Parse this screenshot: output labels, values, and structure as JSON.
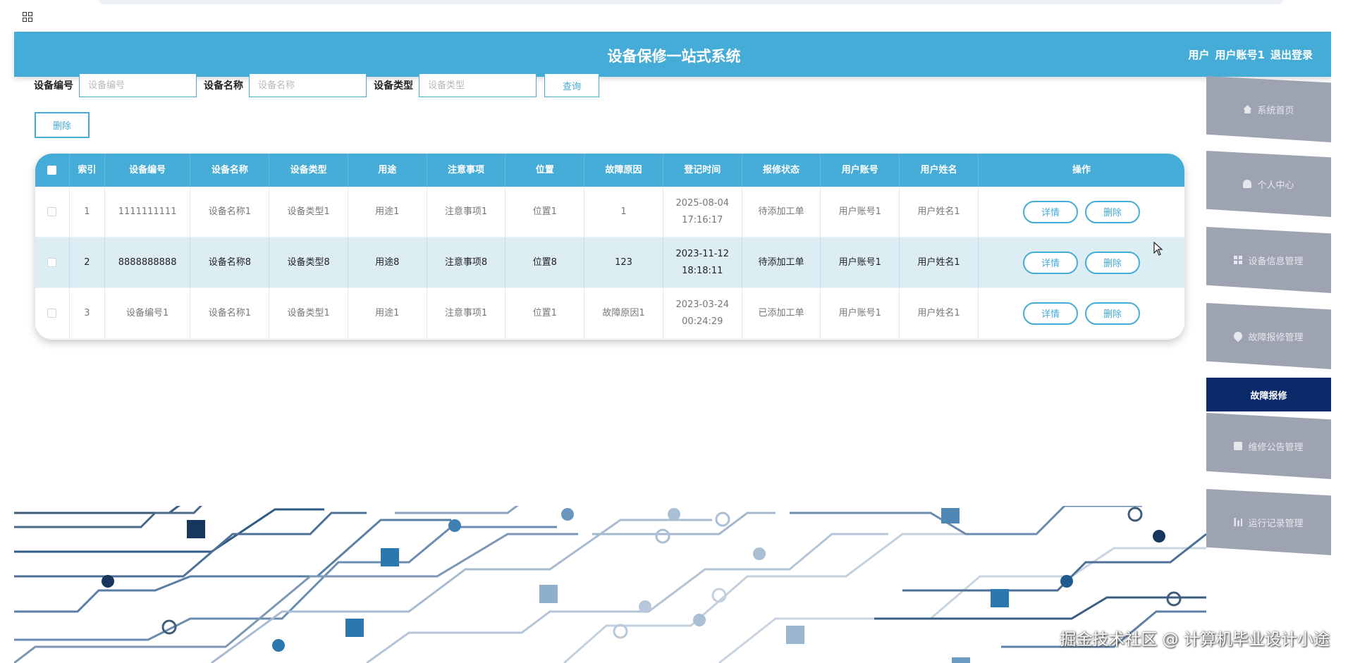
{
  "header": {
    "title": "设备保修一站式系统",
    "user_label": "用户",
    "user_account": "用户账号1",
    "logout": "退出登录"
  },
  "search": {
    "fields": [
      {
        "label": "设备编号",
        "placeholder": "设备编号"
      },
      {
        "label": "设备名称",
        "placeholder": "设备名称"
      },
      {
        "label": "设备类型",
        "placeholder": "设备类型"
      }
    ],
    "query_button": "查询"
  },
  "toolbar": {
    "delete_button": "删除"
  },
  "table": {
    "columns": [
      "索引",
      "设备编号",
      "设备名称",
      "设备类型",
      "用途",
      "注意事项",
      "位置",
      "故障原因",
      "登记时间",
      "报修状态",
      "用户账号",
      "用户姓名",
      "操作"
    ],
    "rows": [
      {
        "index": "1",
        "device_no": "1111111111",
        "device_name": "设备名称1",
        "device_type": "设备类型1",
        "usage": "用途1",
        "notes": "注意事项1",
        "location": "位置1",
        "fault": "1",
        "reg_time": "2025-08-04 17:16:17",
        "status": "待添加工单",
        "account": "用户账号1",
        "username": "用户姓名1"
      },
      {
        "index": "2",
        "device_no": "8888888888",
        "device_name": "设备名称8",
        "device_type": "设备类型8",
        "usage": "用途8",
        "notes": "注意事项8",
        "location": "位置8",
        "fault": "123",
        "reg_time": "2023-11-12 18:18:11",
        "status": "待添加工单",
        "account": "用户账号1",
        "username": "用户姓名1"
      },
      {
        "index": "3",
        "device_no": "设备编号1",
        "device_name": "设备名称1",
        "device_type": "设备类型1",
        "usage": "用途1",
        "notes": "注意事项1",
        "location": "位置1",
        "fault": "故障原因1",
        "reg_time": "2023-03-24 00:24:29",
        "status": "已添加工单",
        "account": "用户账号1",
        "username": "用户姓名1"
      }
    ],
    "detail_button": "详情",
    "row_delete_button": "删除"
  },
  "sidebar": {
    "items": [
      {
        "label": "系统首页",
        "icon": "home-icon"
      },
      {
        "label": "个人中心",
        "icon": "user-icon"
      },
      {
        "label": "设备信息管理",
        "icon": "grid-icon"
      },
      {
        "label": "故障报修管理",
        "icon": "pin-icon"
      },
      {
        "label": "维修公告管理",
        "icon": "clipboard-icon"
      },
      {
        "label": "运行记录管理",
        "icon": "chart-icon"
      }
    ],
    "active_sub": "故障报修"
  },
  "watermark": "掘金技术社区 @ 计算机毕业设计小途",
  "colors": {
    "primary": "#44acd6",
    "active": "#0b2a6a",
    "sidebar": "#9ea3b1"
  }
}
